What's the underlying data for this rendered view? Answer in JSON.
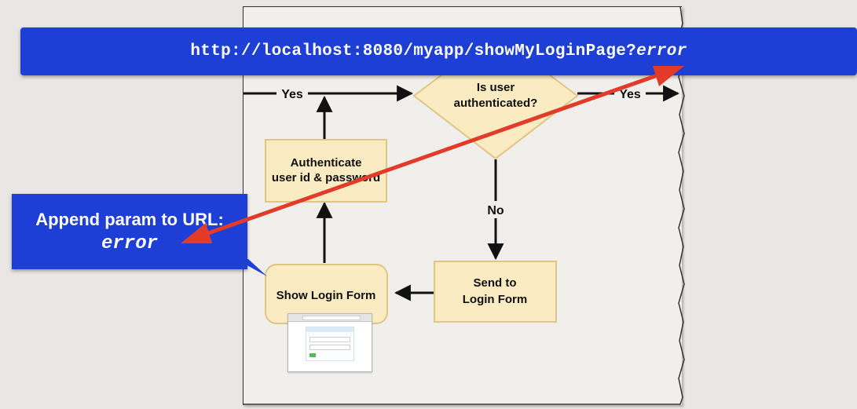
{
  "url_banner": {
    "text": "http://localhost:8080/myapp/showMyLoginPage?",
    "param": "error",
    "color": "#1d3fd6"
  },
  "callout": {
    "line1": "Append param to URL:",
    "line2": "error",
    "color": "#1d3fd6"
  },
  "flowchart": {
    "decision": {
      "line1": "Is user",
      "line2": "authenticated?"
    },
    "authenticate": {
      "line1": "Authenticate",
      "line2": "user id & password"
    },
    "show_login": {
      "label": "Show Login Form"
    },
    "send_login": {
      "line1": "Send to",
      "line2": "Login Form"
    },
    "edges": {
      "yes_left": "Yes",
      "yes_right": "Yes",
      "no": "No"
    },
    "node_fill": "#faebc2",
    "node_stroke": "#e1c680"
  },
  "annotation_arrow": {
    "color": "#e23b2a"
  }
}
